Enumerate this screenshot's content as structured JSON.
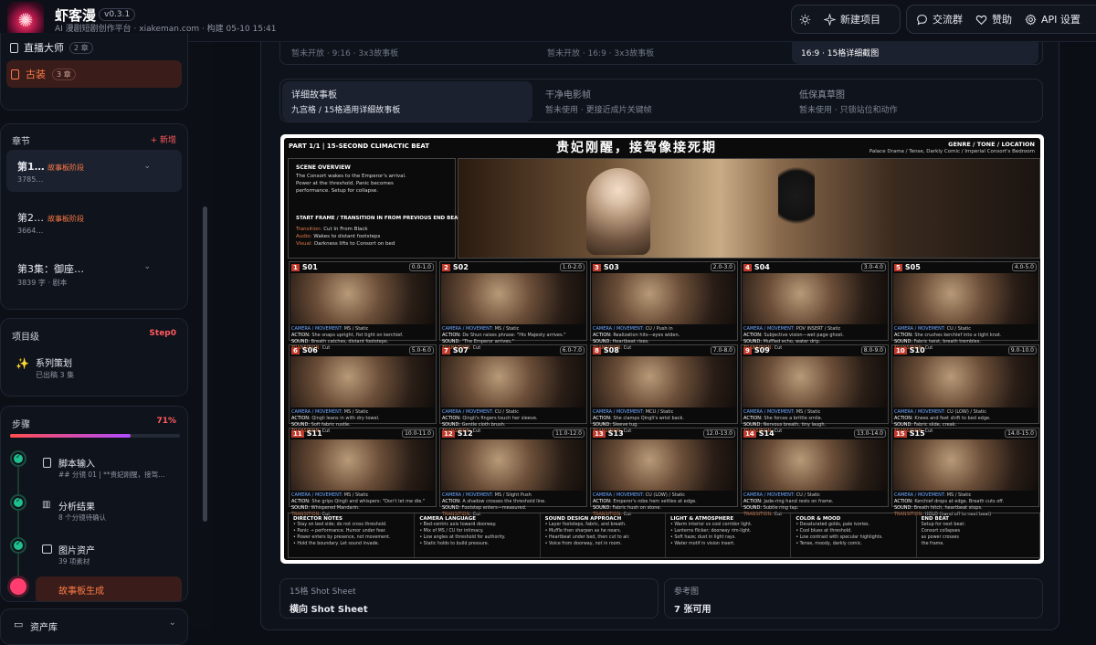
{
  "app": {
    "logo_glyph": "✺",
    "name": "虾客漫",
    "version": "v0.3.1",
    "subtitle": "AI 漫剧短剧创作平台 · xiakeman.com · 构建 05-10 15:41"
  },
  "toolbar": {
    "theme_icon": "sun-icon",
    "new_project": "新建项目",
    "community": "交流群",
    "sponsor": "赞助",
    "api_settings": "API 设置"
  },
  "sidebar": {
    "styles": [
      {
        "label": "直播大师",
        "badge": "2 章"
      },
      {
        "label": "古装",
        "badge": "3 章"
      }
    ],
    "chapters_title": "章节",
    "chapters_add": "+ 新增",
    "chapters": [
      {
        "title": "第1…",
        "tag": "故事板阶段",
        "meta": "3785…"
      },
      {
        "title": "第2…",
        "tag": "故事板阶段",
        "meta": "3664…"
      },
      {
        "title": "第3集：御座…",
        "tag": "",
        "meta": "3839 字 · 剧本"
      }
    ],
    "project_title": "项目级",
    "project_step": "Step0",
    "project_item": {
      "label": "系列策划",
      "meta": "已出稿 3 集"
    },
    "steps_title": "步骤",
    "steps_percent": "71%",
    "progress": 0.71,
    "steps": [
      {
        "label": "脚本输入",
        "meta": "## 分镜 01 | **贵妃刚醒，接驾…"
      },
      {
        "label": "分析结果",
        "meta": "8 个分镜待确认"
      },
      {
        "label": "图片资产",
        "meta": "39 项素材"
      },
      {
        "label": "故事板生成",
        "meta": ""
      }
    ],
    "asset_library": "资产库"
  },
  "main": {
    "top_options": [
      "暂未开放 · 9:16 · 3x3故事板",
      "暂未开放 · 16:9 · 3x3故事板",
      "16:9 · 15格详细截图"
    ],
    "options": [
      {
        "title": "详细故事板",
        "desc": "九宫格 / 15格通用详细故事板"
      },
      {
        "title": "干净电影帧",
        "desc": "暂未使用 · 更接近成片关键帧"
      },
      {
        "title": "低保真草图",
        "desc": "暂未使用 · 只锁站位和动作"
      }
    ],
    "bottom_cards": [
      {
        "label": "15格 Shot Sheet",
        "value": "横向 Shot Sheet"
      },
      {
        "label": "参考图",
        "value": "7 张可用"
      }
    ]
  },
  "board": {
    "part": "PART 1/1  |  15-SECOND CLIMACTIC BEAT",
    "title": "贵妃刚醒，接驾像接死期",
    "genre_label": "GENRE / TONE / LOCATION",
    "genre_value": "Palace Drama / Tense, Darkly Comic / Imperial Consort's Bedroom",
    "scene_overview_title": "SCENE OVERVIEW",
    "scene_overview": [
      "The Consort wakes to the Emperor's arrival.",
      "Power at the threshold. Panic becomes",
      "performance. Setup for collapse."
    ],
    "start_frame_title": "START FRAME / TRANSITION IN FROM PREVIOUS END BEAT",
    "start_frame": [
      {
        "k": "Transition:",
        "v": "Cut In From Black"
      },
      {
        "k": "Audio:",
        "v": "Wakes to distant footsteps"
      },
      {
        "k": "Visual:",
        "v": "Darkness lifts to Consort on bed"
      }
    ],
    "shots": [
      {
        "n": "1",
        "id": "S01",
        "t": "0.0-1.0",
        "cam": "MS / Static",
        "act": "She snaps upright, fist tight on kerchief.",
        "snd": "Breath catches, distant footsteps.",
        "tr": "Cut"
      },
      {
        "n": "2",
        "id": "S02",
        "t": "1.0-2.0",
        "cam": "MS / Static",
        "act": "De Shun raises phrase: \"His Majesty arrives.\"",
        "snd": "\"The Emperor arrives.\"",
        "tr": "Cut"
      },
      {
        "n": "3",
        "id": "S03",
        "t": "2.0-3.0",
        "cam": "CU / Push in",
        "act": "Realization hits—eyes widen.",
        "snd": "Heartbeat rises.",
        "tr": "Cut"
      },
      {
        "n": "4",
        "id": "S04",
        "t": "3.0-4.0",
        "cam": "POV INSERT / Static",
        "act": "Subjective vision—wet page ghost.",
        "snd": "Muffled echo, water drip.",
        "tr": "Cut"
      },
      {
        "n": "5",
        "id": "S05",
        "t": "4.0-5.0",
        "cam": "CU / Static",
        "act": "She crushes kerchief into a tight knot.",
        "snd": "Fabric twist, breath trembles.",
        "tr": "Cut"
      },
      {
        "n": "6",
        "id": "S06",
        "t": "5.0-6.0",
        "cam": "MS / Static",
        "act": "Qingli leans in with dry towel.",
        "snd": "Soft fabric rustle.",
        "tr": "Cut"
      },
      {
        "n": "7",
        "id": "S07",
        "t": "6.0-7.0",
        "cam": "CU / Static",
        "act": "Qingli's fingers touch her sleeve.",
        "snd": "Gentle cloth brush.",
        "tr": "Cut"
      },
      {
        "n": "8",
        "id": "S08",
        "t": "7.0-8.0",
        "cam": "MCU / Static",
        "act": "She clamps Qingli's wrist back.",
        "snd": "Sleeve tug.",
        "tr": "Cut"
      },
      {
        "n": "9",
        "id": "S09",
        "t": "8.0-9.0",
        "cam": "MS / Static",
        "act": "She forces a brittle smile.",
        "snd": "Nervous breath, tiny laugh.",
        "tr": "Cut"
      },
      {
        "n": "10",
        "id": "S10",
        "t": "9.0-10.0",
        "cam": "CU (LOW) / Static",
        "act": "Knees and feet shift to bed edge.",
        "snd": "Fabric slide, creak.",
        "tr": "Cut"
      },
      {
        "n": "11",
        "id": "S11",
        "t": "10.0-11.0",
        "cam": "MS / Static",
        "act": "She grips Qingli and whispers: \"Don't let me die.\"",
        "snd": "Whispered Mandarin.",
        "tr": "Cut"
      },
      {
        "n": "12",
        "id": "S12",
        "t": "11.0-12.0",
        "cam": "MS / Slight Push",
        "act": "A shadow crosses the threshold line.",
        "snd": "Footstep enters—measured.",
        "tr": "Cut"
      },
      {
        "n": "13",
        "id": "S13",
        "t": "12.0-13.0",
        "cam": "CU (LOW) / Static",
        "act": "Emperor's robe hem settles at edge.",
        "snd": "Fabric hush on stone.",
        "tr": "Cut"
      },
      {
        "n": "14",
        "id": "S14",
        "t": "13.0-14.0",
        "cam": "CU / Static",
        "act": "Jade-ring hand rests on frame.",
        "snd": "Subtle ring tap.",
        "tr": "Cut"
      },
      {
        "n": "15",
        "id": "S15",
        "t": "14.0-15.0",
        "cam": "MS / Static",
        "act": "Kerchief drops at edge. Breath cuts off.",
        "snd": "Breath hitch, heartbeat stops.",
        "tr": "HOLD (hand off to next beat)"
      }
    ],
    "labels": {
      "cam": "CAMERA / MOVEMENT:",
      "act": "ACTION:",
      "snd": "SOUND:",
      "tr": "TRANSITION:"
    },
    "notes": [
      {
        "title": "DIRECTOR NOTES",
        "lines": [
          "• Stay on bed side; do not cross threshold.",
          "• Panic → performance. Humor under fear.",
          "• Power enters by presence, not movement.",
          "• Hold the boundary. Let sound invade."
        ]
      },
      {
        "title": "CAMERA LANGUAGE",
        "lines": [
          "• Bed-centric axis toward doorway.",
          "• Mix of MS / CU for intimacy.",
          "• Low angles at threshold for authority.",
          "• Static holds to build pressure."
        ]
      },
      {
        "title": "SOUND DESIGN APPROACH",
        "lines": [
          "• Layer footsteps, fabric, and breath.",
          "• Muffle then sharpen as he nears.",
          "• Heartbeat under bed, then cut to air.",
          "• Voice from doorway, not in room."
        ]
      },
      {
        "title": "LIGHT & ATMOSPHERE",
        "lines": [
          "• Warm interior vs cool corridor light.",
          "• Lanterns flicker; doorway rim-light.",
          "• Soft haze; dust in light rays.",
          "• Water motif in vision insert."
        ]
      },
      {
        "title": "COLOR & MOOD",
        "lines": [
          "• Desaturated golds, pale ivories.",
          "• Cool blues at threshold.",
          "• Low contrast with specular highlights.",
          "• Tense, moody, darkly comic."
        ]
      },
      {
        "title": "END BEAT",
        "lines": [
          "Setup for next beat:",
          "Consort collapses",
          "as power crosses",
          "the frame."
        ]
      }
    ]
  }
}
